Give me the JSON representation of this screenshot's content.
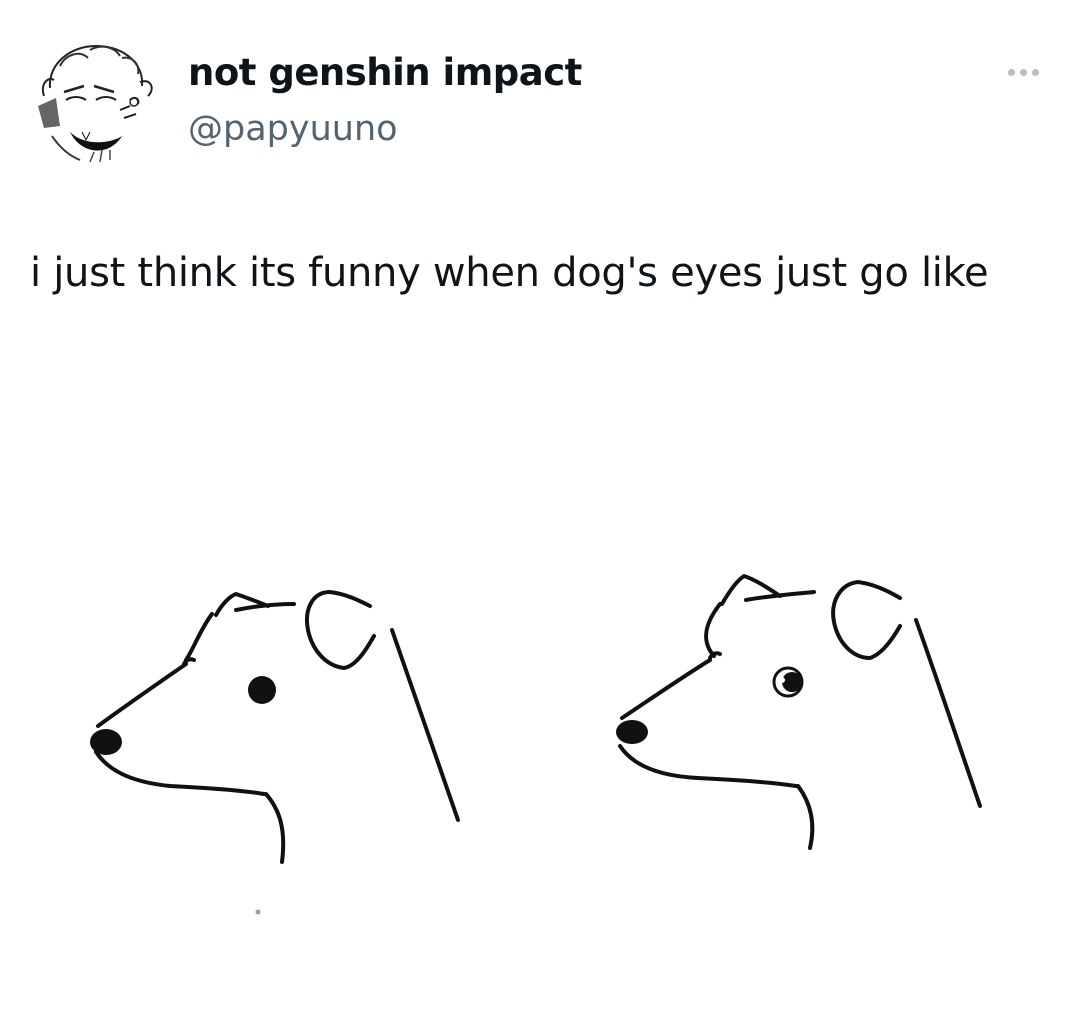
{
  "tweet": {
    "author": {
      "display_name": "not genshin impact",
      "handle": "@papyuuno",
      "avatar_icon": "user-avatar-sketch-icon"
    },
    "more_icon": "more-options-icon",
    "text": "i just think its funny when dog's eyes just go like",
    "media": {
      "description_icon": "dog-sketch-comparison-image",
      "panels": [
        {
          "eye_style": "solid-dot"
        },
        {
          "eye_style": "side-glance"
        }
      ]
    }
  }
}
